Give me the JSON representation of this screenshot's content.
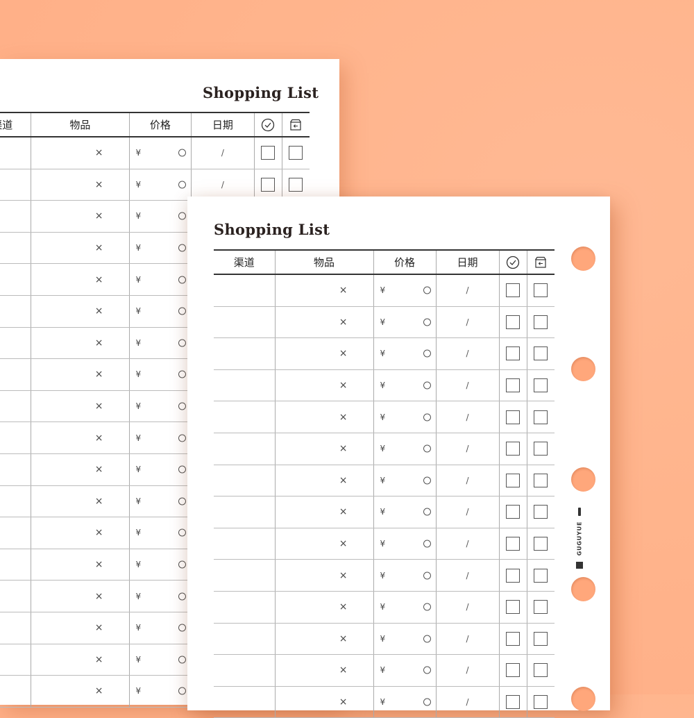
{
  "sheet_back": {
    "title": "Shopping List",
    "headers": {
      "channel": "渠道",
      "item": "物品",
      "price": "价格",
      "date": "日期"
    },
    "header_icons": {
      "done": "check-circle-icon",
      "returned": "return-box-icon"
    },
    "row_marks": {
      "multiply": "×",
      "yen": "¥",
      "slash": "/"
    },
    "row_count": 18
  },
  "sheet_front": {
    "title": "Shopping List",
    "headers": {
      "channel": "渠道",
      "item": "物品",
      "price": "价格",
      "date": "日期"
    },
    "header_icons": {
      "done": "check-circle-icon",
      "returned": "return-box-icon"
    },
    "row_marks": {
      "multiply": "×",
      "yen": "¥",
      "slash": "/"
    },
    "row_count": 14
  },
  "brand": {
    "name": "GUGUYUE"
  },
  "colors": {
    "background": "#ffb48c",
    "hole": "#ffa77b",
    "ink": "#2b2220"
  }
}
